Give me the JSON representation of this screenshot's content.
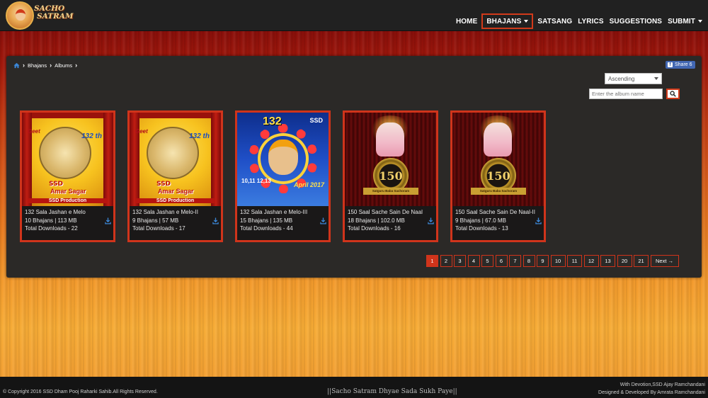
{
  "site": {
    "logo_line1": "SACHO",
    "logo_line2": "SATRAM"
  },
  "nav": {
    "items": [
      {
        "label": "HOME"
      },
      {
        "label": "BHAJANS",
        "active": true
      },
      {
        "label": "SATSANG"
      },
      {
        "label": "LYRICS"
      },
      {
        "label": "SUGGESTIONS"
      },
      {
        "label": "SUBMIT"
      }
    ]
  },
  "breadcrumb": {
    "items": [
      "Bhajans",
      "Albums"
    ]
  },
  "share": {
    "label": "Share 6"
  },
  "sort": {
    "selected": "Ascending"
  },
  "search": {
    "placeholder": "Enter the album name"
  },
  "albums": [
    {
      "title": "132 Sala Jashan e Melo",
      "stats": "10 Bhajans | 113 MB",
      "downloads": "Total Downloads - 22",
      "art": "geet-amar-sagar",
      "art_text": {
        "geet": "Geet",
        "title1": "SSD",
        "title2": "Amar Sagar",
        "production": "SSD Production",
        "year": "132 th"
      }
    },
    {
      "title": "132 Sala Jashan e Melo-II",
      "stats": "9 Bhajans | 57 MB",
      "downloads": "Total Downloads - 17",
      "art": "geet-amar-sagar",
      "art_text": {
        "geet": "Geet",
        "title1": "SSD",
        "title2": "Amar Sagar",
        "production": "SSD Production",
        "year": "132 th"
      }
    },
    {
      "title": "132 Sala Jashan e Melo-III",
      "stats": "15 Bhajans | 135 MB",
      "downloads": "Total Downloads - 44",
      "art": "132-april-2017",
      "art_text": {
        "num": "132",
        "ssd": "SSD",
        "dates": "10,11 12,13",
        "month": "April 2017"
      }
    },
    {
      "title": "150 Saal Sache Sain De Naal",
      "stats": "18 Bhajans | 102.0 MB",
      "downloads": "Total Downloads - 16",
      "art": "150-years",
      "art_text": {
        "badge": "150",
        "ribbon": "Satguru Baba Sachoram"
      }
    },
    {
      "title": "150 Saal Sache Sain De Naal-II",
      "stats": "9 Bhajans | 67.0 MB",
      "downloads": "Total Downloads - 13",
      "art": "150-years",
      "art_text": {
        "badge": "150",
        "ribbon": "Satguru Baba Sachoram"
      }
    }
  ],
  "pagination": {
    "pages": [
      "1",
      "2",
      "3",
      "4",
      "5",
      "6",
      "7",
      "8",
      "9",
      "10",
      "11",
      "12",
      "13",
      "20",
      "21"
    ],
    "active": "1",
    "next_label": "Next →"
  },
  "footer": {
    "copyright": "© Copyright 2016 SSD Dham Pooj Raharki Sahib.All Rights Reserved.",
    "tagline": "||Sacho Satram Dhyae Sada Sukh Paye||",
    "credit_line1": "With Devotion,SSD Ajay Ramchandani",
    "credit_line2": "Designed & Developed By Amrata Ramchandani"
  },
  "colors": {
    "accent": "#d0341b",
    "navbar": "#212121",
    "panel": "#2b2927",
    "facebook": "#4267b2"
  }
}
